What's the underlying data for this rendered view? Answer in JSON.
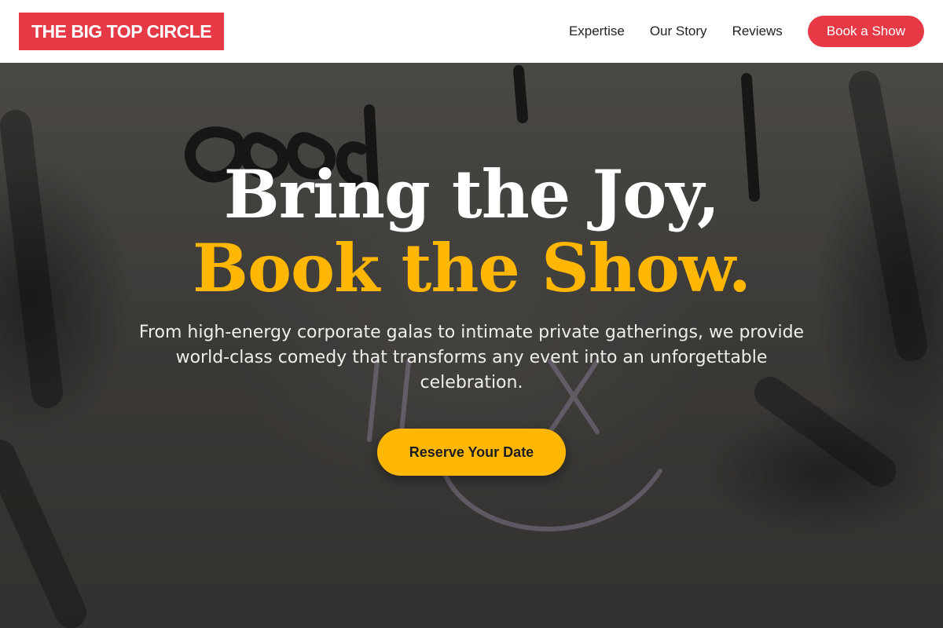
{
  "header": {
    "logo_text": "THE BIG TOP CIRCLE",
    "nav": [
      {
        "label": "Expertise"
      },
      {
        "label": "Our Story"
      },
      {
        "label": "Reviews"
      }
    ],
    "cta_label": "Book a Show"
  },
  "hero": {
    "headline_line1": "Bring the Joy,",
    "headline_line2": "Book the Show.",
    "subtext": "From high-energy corporate galas to intimate private gatherings, we provide world-class comedy that transforms any event into an unforgettable celebration.",
    "cta_label": "Reserve Your Date"
  },
  "colors": {
    "brand_red": "#e63946",
    "accent_yellow": "#ffb703",
    "header_bg": "#ffffff",
    "hero_text": "#ffffff"
  }
}
